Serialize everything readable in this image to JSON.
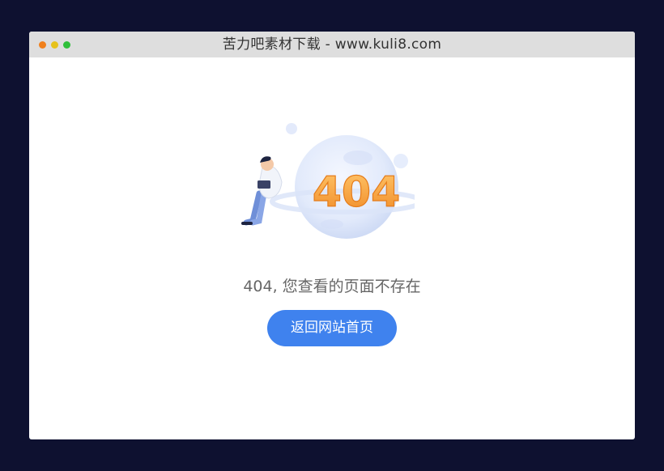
{
  "window": {
    "title": "苦力吧素材下载 - www.kuli8.com",
    "controls": [
      "close",
      "minimize",
      "maximize"
    ]
  },
  "illustration": {
    "code_text": "404",
    "description_icon": "person-sitting-on-planet-icon"
  },
  "page": {
    "error_message": "404, 您查看的页面不存在",
    "home_button_label": "返回网站首页"
  },
  "colors": {
    "background": "#0e1130",
    "title_bar": "#dedede",
    "accent_button": "#3f82ee",
    "code_orange": "#f5a03a",
    "message_text": "#666666"
  }
}
